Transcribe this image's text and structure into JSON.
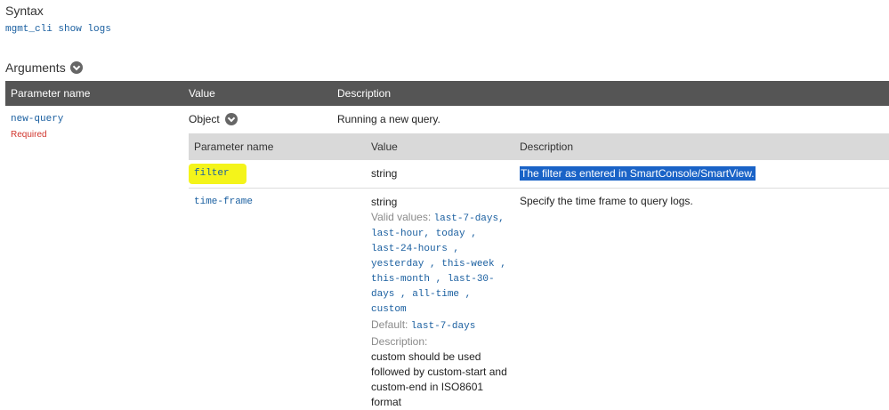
{
  "syntax": {
    "heading": "Syntax",
    "command": "mgmt_cli show logs"
  },
  "arguments": {
    "heading": "Arguments"
  },
  "table": {
    "headers": [
      "Parameter name",
      "Value",
      "Description"
    ],
    "row": {
      "param": "new-query",
      "required": "Required",
      "value": "Object",
      "description": "Running a new query."
    }
  },
  "subtable": {
    "headers": [
      "Parameter name",
      "Value",
      "Description"
    ],
    "rows": [
      {
        "param": "filter",
        "value": "string",
        "description": "The filter as entered in SmartConsole/SmartView."
      },
      {
        "param": "time-frame",
        "value": "string",
        "valid_values_label": "Valid values:",
        "valid_lines": [
          "last-7-days,",
          "last-hour, today ,",
          "last-24-hours ,",
          "yesterday , this-week ,",
          "this-month , last-30-",
          "days , all-time ,",
          "custom"
        ],
        "default_label": "Default:",
        "default_value": "last-7-days",
        "desc_label": "Description:",
        "desc_lines": [
          "custom should be used",
          "followed by custom-start and",
          "custom-end in ISO8601",
          "format"
        ],
        "description": "Specify the time frame to query logs."
      }
    ]
  }
}
